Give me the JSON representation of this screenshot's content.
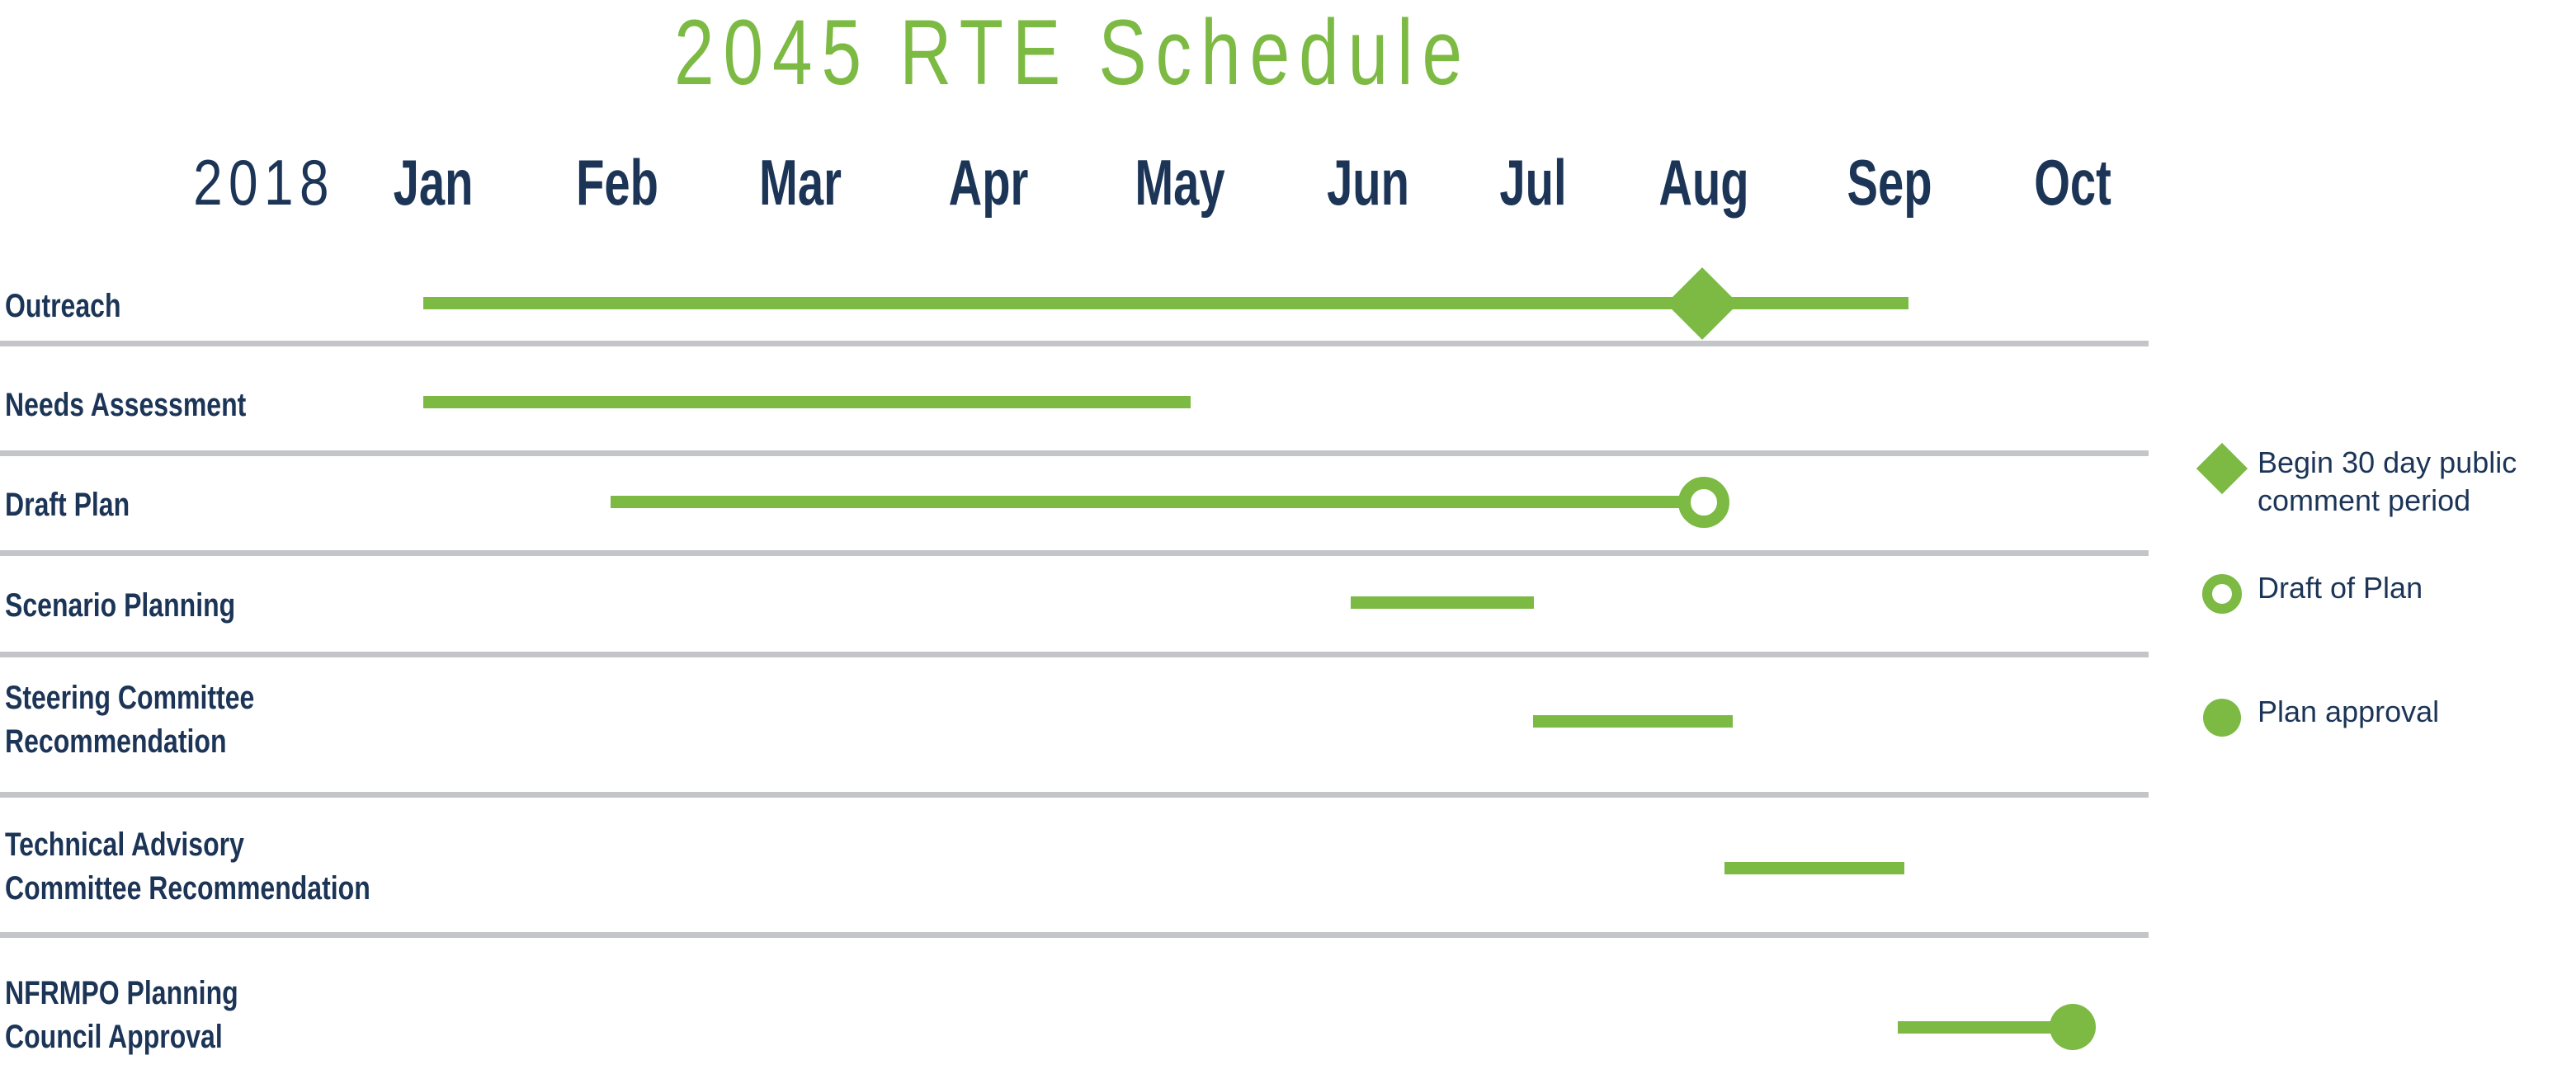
{
  "title": "2045 RTE Schedule",
  "colors": {
    "accent_green": "#7CBA44",
    "navy": "#1C3557",
    "divider_gray": "#C3C5C8",
    "background": "#FFFFFF"
  },
  "axis": {
    "year_label": "2018",
    "months": [
      "Jan",
      "Feb",
      "Mar",
      "Apr",
      "May",
      "Jun",
      "Jul",
      "Aug",
      "Sep",
      "Oct"
    ]
  },
  "legend": {
    "items": [
      {
        "glyph": "diamond-marker-icon",
        "label": "Begin 30 day public\ncomment period"
      },
      {
        "glyph": "ring-marker-icon",
        "label": "Draft of Plan"
      },
      {
        "glyph": "dot-marker-icon",
        "label": "Plan approval"
      }
    ]
  },
  "rows": [
    {
      "label": "Outreach"
    },
    {
      "label": "Needs Assessment"
    },
    {
      "label": "Draft Plan"
    },
    {
      "label": "Scenario Planning"
    },
    {
      "label": "Steering Committee\nRecommendation"
    },
    {
      "label": "Technical Advisory\nCommittee Recommendation"
    },
    {
      "label": "NFRMPO Planning\nCouncil Approval"
    }
  ],
  "chart_data": {
    "type": "bar",
    "chart_kind": "gantt",
    "title": "2045 RTE Schedule",
    "xlabel": "2018",
    "ylabel": "",
    "categories": [
      "Outreach",
      "Needs Assessment",
      "Draft Plan",
      "Scenario Planning",
      "Steering Committee Recommendation",
      "Technical Advisory Committee Recommendation",
      "NFRMPO Planning Council Approval"
    ],
    "x_axis_ticks": [
      "Jan",
      "Feb",
      "Mar",
      "Apr",
      "May",
      "Jun",
      "Jul",
      "Aug",
      "Sep",
      "Oct"
    ],
    "x_axis_units": "month of 2018",
    "grid": "horizontal row dividers only",
    "legend_position": "right",
    "tasks": [
      {
        "name": "Outreach",
        "start_month": "Jan",
        "end_month": "Sep",
        "start_index": 0.0,
        "end_index": 7.9,
        "markers": [
          {
            "type": "diamond",
            "month": "Aug",
            "index": 6.75,
            "meaning": "Begin 30 day public comment period"
          }
        ]
      },
      {
        "name": "Needs Assessment",
        "start_month": "Jan",
        "end_month": "May",
        "start_index": 0.0,
        "end_index": 4.1,
        "markers": []
      },
      {
        "name": "Draft Plan",
        "start_month": "Feb",
        "end_month": "Aug",
        "start_index": 1.0,
        "end_index": 6.75,
        "markers": [
          {
            "type": "ring",
            "month": "Aug",
            "index": 6.75,
            "meaning": "Draft of Plan"
          }
        ]
      },
      {
        "name": "Scenario Planning",
        "start_month": "Jun",
        "end_month": "Jun",
        "start_index": 4.85,
        "end_index": 5.55,
        "markers": []
      },
      {
        "name": "Steering Committee Recommendation",
        "start_month": "Jul",
        "end_month": "Aug",
        "start_index": 5.75,
        "end_index": 6.5,
        "markers": []
      },
      {
        "name": "Technical Advisory Committee Recommendation",
        "start_month": "Aug",
        "end_month": "Sep",
        "start_index": 6.8,
        "end_index": 7.5,
        "markers": []
      },
      {
        "name": "NFRMPO Planning Council Approval",
        "start_month": "Sep",
        "end_month": "Oct",
        "start_index": 7.8,
        "end_index": 8.75,
        "markers": [
          {
            "type": "dot",
            "month": "Oct",
            "index": 8.75,
            "meaning": "Plan approval"
          }
        ]
      }
    ]
  }
}
